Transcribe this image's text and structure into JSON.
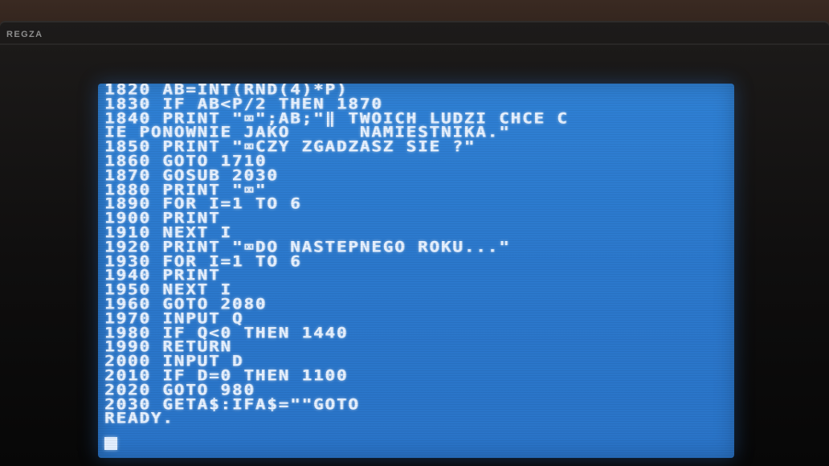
{
  "tv": {
    "brand": "REGZA"
  },
  "terminal": {
    "lines": [
      "1820 AB=INT(RND(4)*P)",
      "1830 IF AB<P/2 THEN 1870",
      "1840 PRINT \"⌧\";AB;\"‖ TWOICH LUDZI CHCE C",
      "IE PONOWNIE JAKO      NAMIESTNIKA.\"",
      "1850 PRINT \"⌧CZY ZGADZASZ SIE ?\"",
      "1860 GOTO 1710",
      "1870 GOSUB 2030",
      "1880 PRINT \"⌧\"",
      "1890 FOR I=1 TO 6",
      "1900 PRINT",
      "1910 NEXT I",
      "1920 PRINT \"⌧DO NASTEPNEGO ROKU...\"",
      "1930 FOR I=1 TO 6",
      "1940 PRINT",
      "1950 NEXT I",
      "1960 GOTO 2080",
      "1970 INPUT Q",
      "1980 IF Q<0 THEN 1440",
      "1990 RETURN",
      "2000 INPUT D",
      "2010 IF D=0 THEN 1100",
      "2020 GOTO 980",
      "2030 GETA$:IFA$=\"\"GOTO",
      "READY."
    ],
    "cursor_color": "#e3efff",
    "screen_color": "#2c79cd",
    "text_color": "#e7f1ff"
  }
}
